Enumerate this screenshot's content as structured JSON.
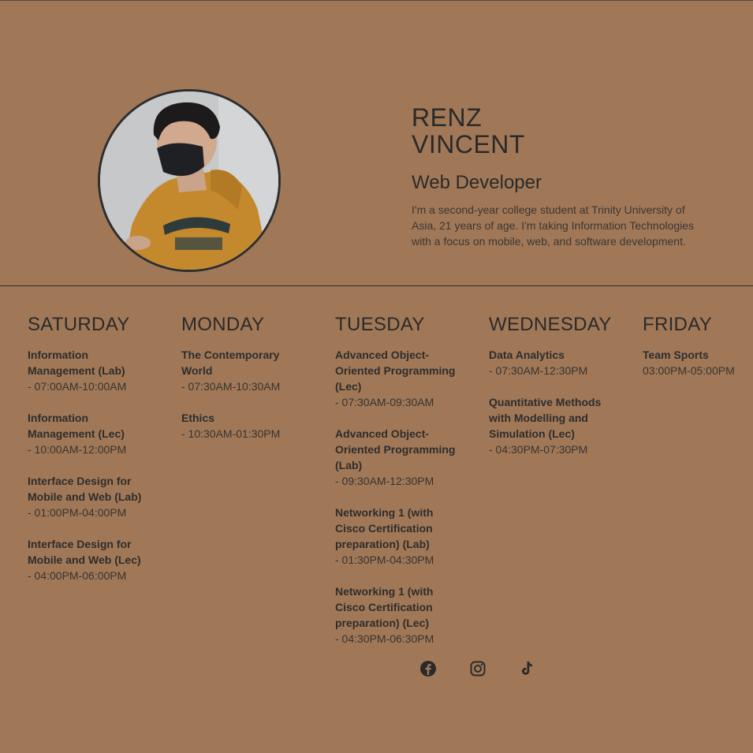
{
  "profile": {
    "first_name": "RENZ",
    "last_name": "VINCENT",
    "role": "Web Developer",
    "bio": "I'm a second-year college student at Trinity University of Asia, 21 years of age. I'm taking Information Technologies with a focus on mobile, web, and software development."
  },
  "schedule": [
    {
      "day": "SATURDAY",
      "courses": [
        {
          "title": "Information Management (Lab)",
          "time": "- 07:00AM-10:00AM"
        },
        {
          "title": "Information Management (Lec)",
          "time": "- 10:00AM-12:00PM"
        },
        {
          "title": "Interface Design for Mobile and Web (Lab)",
          "time": "- 01:00PM-04:00PM"
        },
        {
          "title": "Interface Design for Mobile and Web (Lec)",
          "time": "- 04:00PM-06:00PM"
        }
      ]
    },
    {
      "day": "MONDAY",
      "courses": [
        {
          "title": "The Contemporary World",
          "time": "- 07:30AM-10:30AM"
        },
        {
          "title": "Ethics",
          "time": "- 10:30AM-01:30PM"
        }
      ]
    },
    {
      "day": "TUESDAY",
      "courses": [
        {
          "title": "Advanced Object-Oriented Programming (Lec)",
          "time": "- 07:30AM-09:30AM"
        },
        {
          "title": "Advanced Object-Oriented Programming (Lab)",
          "time": "- 09:30AM-12:30PM"
        },
        {
          "title": "Networking 1 (with Cisco Certification preparation) (Lab)",
          "time": "- 01:30PM-04:30PM"
        },
        {
          "title": "Networking 1 (with Cisco Certification preparation) (Lec)",
          "time": "- 04:30PM-06:30PM"
        }
      ]
    },
    {
      "day": "WEDNESDAY",
      "courses": [
        {
          "title": "Data Analytics",
          "time": "- 07:30AM-12:30PM"
        },
        {
          "title": "Quantitative Methods with Modelling and Simulation (Lec)",
          "time": "- 04:30PM-07:30PM"
        }
      ]
    },
    {
      "day": "FRIDAY",
      "courses": [
        {
          "title": "Team Sports",
          "time": "03:00PM-05:00PM"
        }
      ]
    }
  ],
  "socials": [
    {
      "icon": "facebook-icon"
    },
    {
      "icon": "instagram-icon"
    },
    {
      "icon": "tiktok-icon"
    }
  ],
  "colors": {
    "background": "#a17857",
    "text": "#2b2a28"
  }
}
